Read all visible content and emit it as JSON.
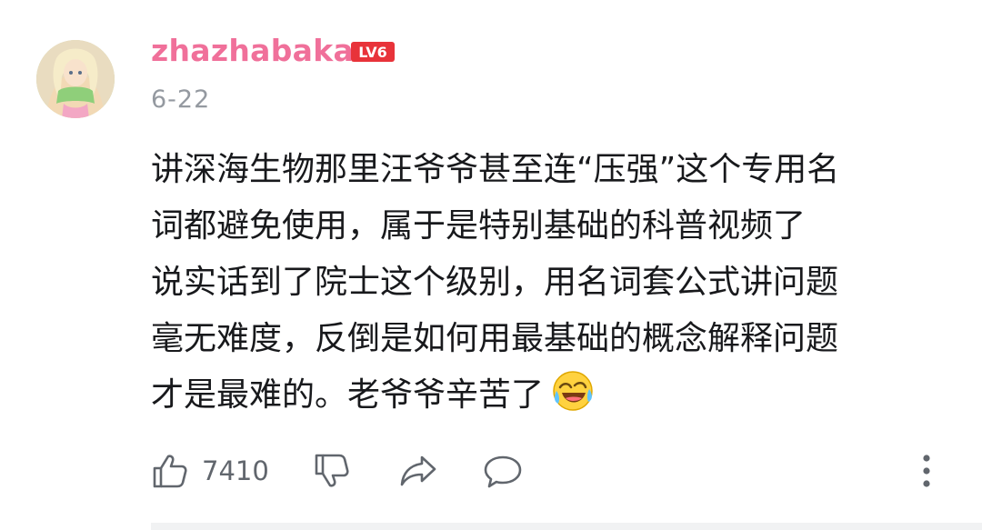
{
  "comment": {
    "username": "zhazhabaka",
    "level": "LV6",
    "date": "6-22",
    "content_lines": [
      "讲深海生物那里汪爷爷甚至连“压强”这个专用名",
      "词都避免使用，属于是特别基础的科普视频了",
      "说实话到了院士这个级别，用名词套公式讲问题",
      "毫无难度，反倒是如何用最基础的概念解释问题",
      "才是最难的。老爷爷辛苦了"
    ],
    "emoji": "laughing-crying-emoji",
    "likes": "7410"
  },
  "colors": {
    "username": "#f0709a",
    "level_badge": "#e8333a",
    "meta_text": "#9499a0",
    "content_text": "#18191c",
    "icon": "#61666d",
    "divider": "#f1f2f3"
  },
  "icons": {
    "like": "thumbs-up-icon",
    "dislike": "thumbs-down-icon",
    "share": "share-arrow-icon",
    "reply": "speech-bubble-icon",
    "more": "vertical-dots-icon"
  }
}
